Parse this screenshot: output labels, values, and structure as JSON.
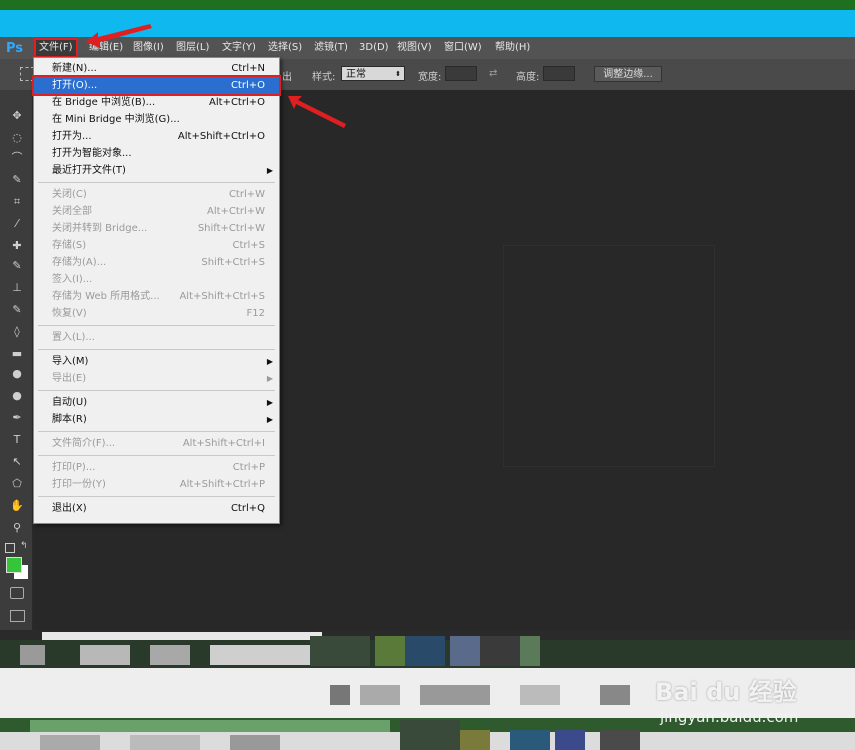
{
  "app": {
    "logo": "Ps"
  },
  "menu_bar": [
    {
      "label": "文件(F)",
      "active": true
    },
    {
      "label": "编辑(E)"
    },
    {
      "label": "图像(I)"
    },
    {
      "label": "图层(L)"
    },
    {
      "label": "文字(Y)"
    },
    {
      "label": "选择(S)"
    },
    {
      "label": "滤镜(T)"
    },
    {
      "label": "3D(D)"
    },
    {
      "label": "视图(V)"
    },
    {
      "label": "窗口(W)"
    },
    {
      "label": "帮助(H)"
    }
  ],
  "options_bar": {
    "partial_label": "出",
    "style_label": "样式:",
    "style_value": "正常",
    "width_label": "宽度:",
    "height_label": "高度:",
    "refine_button": "调整边缘..."
  },
  "file_menu": {
    "items": [
      {
        "label": "新建(N)...",
        "shortcut": "Ctrl+N"
      },
      {
        "label": "打开(O)...",
        "shortcut": "Ctrl+O",
        "highlighted": true
      },
      {
        "label": "在 Bridge 中浏览(B)...",
        "shortcut": "Alt+Ctrl+O"
      },
      {
        "label": "在 Mini Bridge 中浏览(G)...",
        "shortcut": ""
      },
      {
        "label": "打开为...",
        "shortcut": "Alt+Shift+Ctrl+O"
      },
      {
        "label": "打开为智能对象...",
        "shortcut": ""
      },
      {
        "label": "最近打开文件(T)",
        "shortcut": "",
        "submenu": true
      },
      {
        "separator": true
      },
      {
        "label": "关闭(C)",
        "shortcut": "Ctrl+W",
        "disabled": true
      },
      {
        "label": "关闭全部",
        "shortcut": "Alt+Ctrl+W",
        "disabled": true
      },
      {
        "label": "关闭并转到 Bridge...",
        "shortcut": "Shift+Ctrl+W",
        "disabled": true
      },
      {
        "label": "存储(S)",
        "shortcut": "Ctrl+S",
        "disabled": true
      },
      {
        "label": "存储为(A)...",
        "shortcut": "Shift+Ctrl+S",
        "disabled": true
      },
      {
        "label": "签入(I)...",
        "shortcut": "",
        "disabled": true
      },
      {
        "label": "存储为 Web 所用格式...",
        "shortcut": "Alt+Shift+Ctrl+S",
        "disabled": true
      },
      {
        "label": "恢复(V)",
        "shortcut": "F12",
        "disabled": true
      },
      {
        "separator": true
      },
      {
        "label": "置入(L)...",
        "shortcut": "",
        "disabled": true
      },
      {
        "separator": true
      },
      {
        "label": "导入(M)",
        "shortcut": "",
        "submenu": true
      },
      {
        "label": "导出(E)",
        "shortcut": "",
        "submenu": true,
        "disabled": true
      },
      {
        "separator": true
      },
      {
        "label": "自动(U)",
        "shortcut": "",
        "submenu": true
      },
      {
        "label": "脚本(R)",
        "shortcut": "",
        "submenu": true
      },
      {
        "separator": true
      },
      {
        "label": "文件简介(F)...",
        "shortcut": "Alt+Shift+Ctrl+I",
        "disabled": true
      },
      {
        "separator": true
      },
      {
        "label": "打印(P)...",
        "shortcut": "Ctrl+P",
        "disabled": true
      },
      {
        "label": "打印一份(Y)",
        "shortcut": "Alt+Shift+Ctrl+P",
        "disabled": true
      },
      {
        "separator": true
      },
      {
        "label": "退出(X)",
        "shortcut": "Ctrl+Q"
      }
    ]
  },
  "tools": [
    "move-icon",
    "marquee-icon",
    "lasso-icon",
    "quick-select-icon",
    "crop-icon",
    "eyedropper-icon",
    "healing-icon",
    "brush-icon",
    "stamp-icon",
    "history-brush-icon",
    "eraser-icon",
    "gradient-icon",
    "blur-icon",
    "dodge-icon",
    "pen-icon",
    "type-icon",
    "path-select-icon",
    "shape-icon",
    "hand-icon",
    "zoom-icon"
  ],
  "colors": {
    "title_bar": "#10b8f0",
    "highlight": "#2a6fd0",
    "annotation_red": "#e02020",
    "foreground_swatch": "#36c43a"
  },
  "watermark": {
    "brand": "Bai du 经验",
    "url": "jingyan.baidu.com"
  }
}
